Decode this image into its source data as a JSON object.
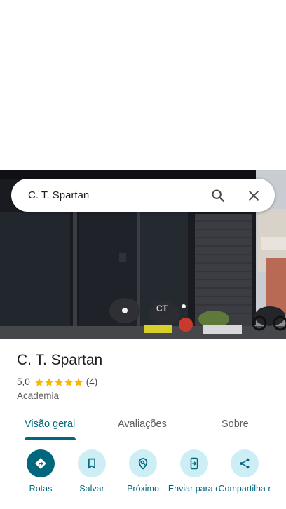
{
  "search": {
    "query": "C. T. Spartan",
    "search_icon": "search-icon",
    "close_icon": "close-icon"
  },
  "photo": {
    "sign_text": "CT"
  },
  "place": {
    "name": "C. T. Spartan",
    "rating": "5,0",
    "stars": 5,
    "review_count": "(4)",
    "category": "Academia"
  },
  "tabs": [
    {
      "label": "Visão geral",
      "active": true
    },
    {
      "label": "Avaliações",
      "active": false
    },
    {
      "label": "Sobre",
      "active": false
    }
  ],
  "actions": [
    {
      "label": "Rotas",
      "icon": "directions-icon"
    },
    {
      "label": "Salvar",
      "icon": "bookmark-icon"
    },
    {
      "label": "Próximo",
      "icon": "nearby-icon"
    },
    {
      "label": "Enviar para o",
      "icon": "send-to-phone-icon"
    },
    {
      "label": "Compartilha r",
      "icon": "share-icon"
    }
  ],
  "colors": {
    "accent": "#00677d",
    "chip_bg": "#ceeef6",
    "star": "#f6b800"
  }
}
